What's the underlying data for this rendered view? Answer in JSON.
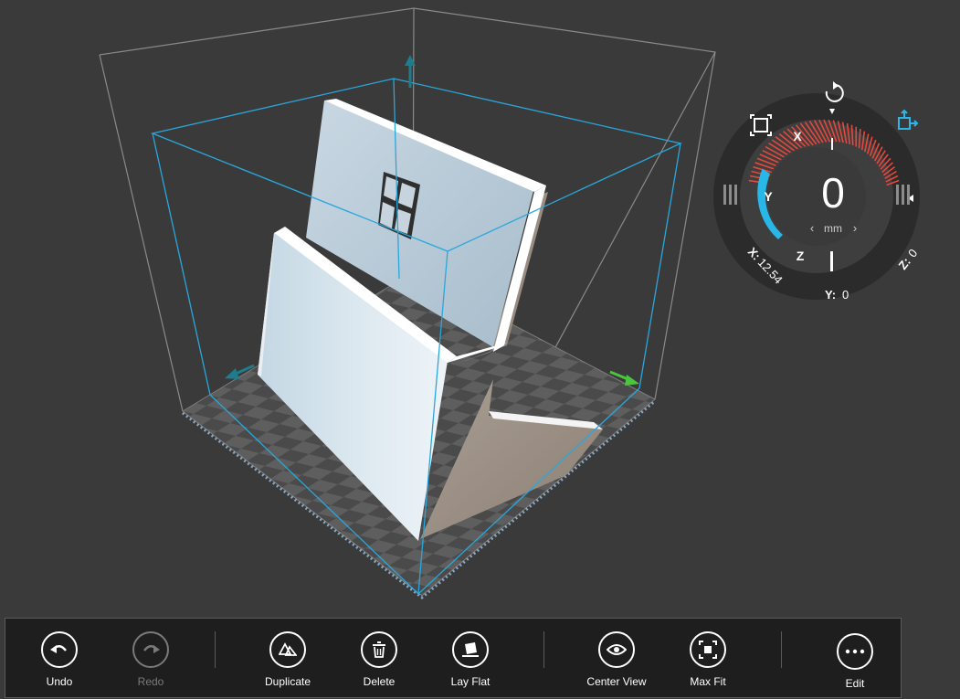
{
  "toolbar": {
    "undo_label": "Undo",
    "redo_label": "Redo",
    "duplicate_label": "Duplicate",
    "delete_label": "Delete",
    "layflat_label": "Lay Flat",
    "centerview_label": "Center View",
    "maxfit_label": "Max Fit",
    "edit_label": "Edit",
    "redo_enabled": false
  },
  "dial": {
    "value": "0",
    "unit": "mm",
    "axis_x": "X",
    "axis_y": "Y",
    "axis_z": "Z",
    "readout_x_label": "X:",
    "readout_x_value": "12.54",
    "readout_y_label": "Y:",
    "readout_y_value": "0",
    "readout_z_label": "Z:",
    "readout_z_value": "0",
    "active_axis": "Y",
    "accent_color": "#29b6e8",
    "tick_color": "#e5483c"
  },
  "icons": {
    "undo": "undo-arrow-icon",
    "redo": "redo-arrow-icon",
    "duplicate": "duplicate-icon",
    "delete": "trash-icon",
    "layflat": "lay-flat-icon",
    "centerview": "eye-icon",
    "maxfit": "max-fit-icon",
    "edit": "more-dots-icon",
    "rotate": "rotate-icon",
    "scale": "scale-icon",
    "move": "move-icon"
  }
}
